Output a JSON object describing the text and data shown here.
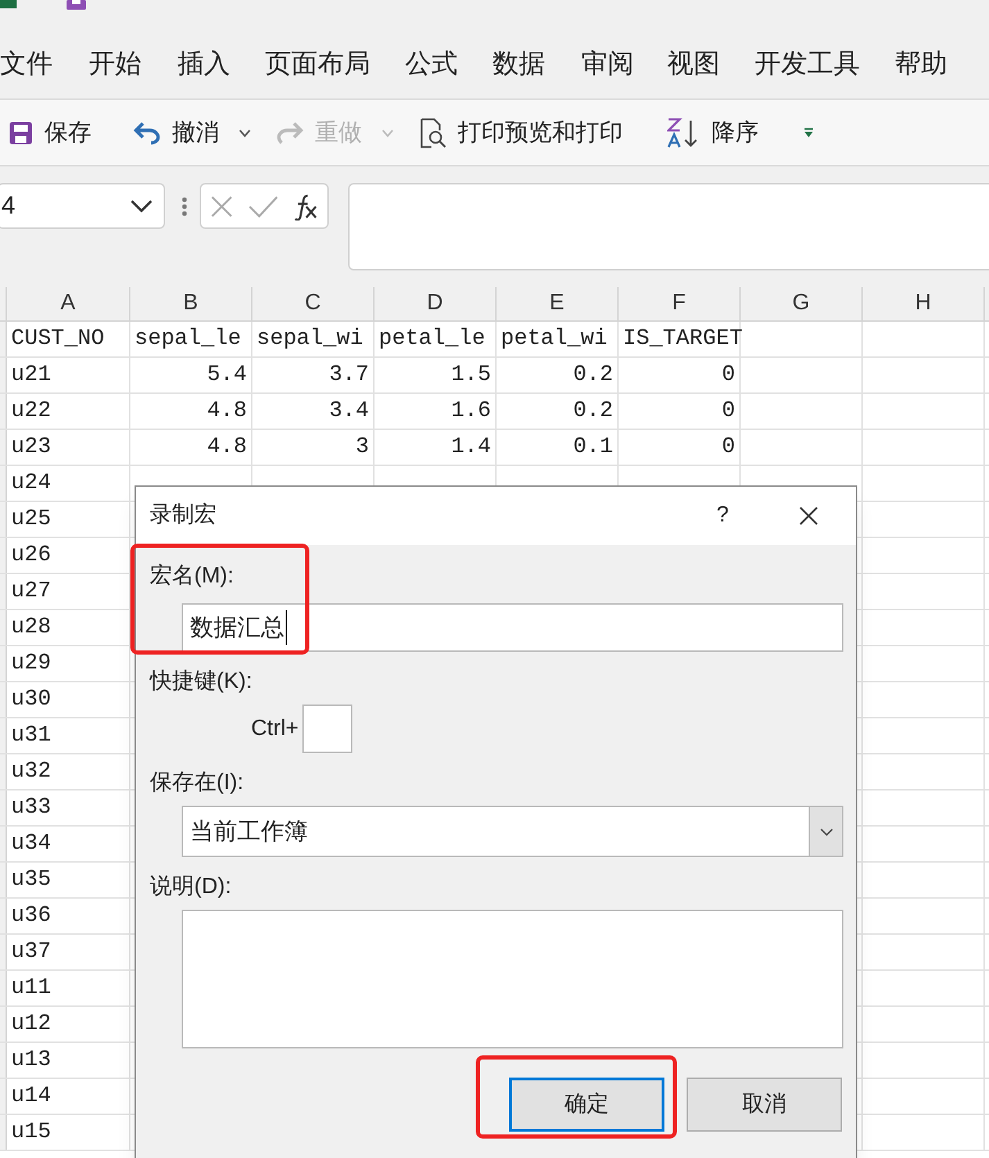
{
  "ribbon_tabs": [
    "文件",
    "开始",
    "插入",
    "页面布局",
    "公式",
    "数据",
    "审阅",
    "视图",
    "开发工具",
    "帮助"
  ],
  "quick_access": [
    {
      "label": "保存",
      "disabled": false,
      "menu": false
    },
    {
      "label": "撤消",
      "disabled": false,
      "menu": true
    },
    {
      "label": "重做",
      "disabled": true,
      "menu": true
    },
    {
      "label": "打印预览和打印",
      "disabled": false,
      "menu": false
    },
    {
      "label": "降序",
      "disabled": false,
      "menu": false
    }
  ],
  "name_box": {
    "value": "4"
  },
  "sheet": {
    "columns": [
      "A",
      "B",
      "C",
      "D",
      "E",
      "F",
      "G",
      "H"
    ],
    "rows": [
      [
        "CUST_NO",
        "sepal_le",
        "sepal_wi",
        "petal_le",
        "petal_wi",
        "IS_TARGET"
      ],
      [
        "u21",
        "5.4",
        "3.7",
        "1.5",
        "0.2",
        "0"
      ],
      [
        "u22",
        "4.8",
        "3.4",
        "1.6",
        "0.2",
        "0"
      ],
      [
        "u23",
        "4.8",
        "3",
        "1.4",
        "0.1",
        "0"
      ],
      [
        "u24"
      ],
      [
        "u25"
      ],
      [
        "u26"
      ],
      [
        "u27"
      ],
      [
        "u28"
      ],
      [
        "u29"
      ],
      [
        "u30"
      ],
      [
        "u31"
      ],
      [
        "u32"
      ],
      [
        "u33"
      ],
      [
        "u34"
      ],
      [
        "u35"
      ],
      [
        "u36"
      ],
      [
        "u37"
      ],
      [
        "u11"
      ],
      [
        "u12"
      ],
      [
        "u13"
      ],
      [
        "u14"
      ],
      [
        "u15"
      ]
    ]
  },
  "dialog": {
    "title": "录制宏",
    "help": "?",
    "fields": [
      {
        "kind": "text",
        "label": "宏名(M):",
        "value": "数据汇总",
        "highlighted": true
      },
      {
        "kind": "shortcut",
        "label": "快捷键(K):",
        "prefix": "Ctrl+"
      },
      {
        "kind": "select",
        "label": "保存在(I):",
        "value": "当前工作簿"
      },
      {
        "kind": "textarea",
        "label": "说明(D):"
      }
    ],
    "buttons": [
      {
        "label": "确定",
        "default": true,
        "highlighted": true
      },
      {
        "label": "取消",
        "default": false,
        "highlighted": false
      }
    ]
  }
}
